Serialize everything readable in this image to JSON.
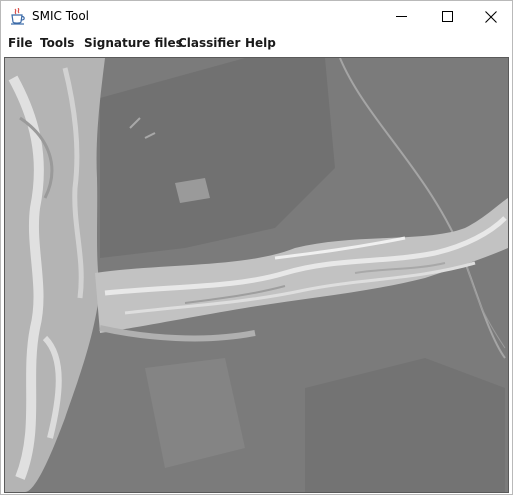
{
  "window": {
    "title": "SMIC Tool",
    "app_icon": "java-coffee-cup-icon",
    "controls": {
      "minimize_icon": "minimize-icon",
      "maximize_icon": "maximize-icon",
      "close_icon": "close-icon"
    }
  },
  "menubar": {
    "items": [
      {
        "label": "File"
      },
      {
        "label": "Tools"
      },
      {
        "label": "Signature files"
      },
      {
        "label": "Classifier"
      },
      {
        "label": "Help"
      }
    ]
  },
  "main": {
    "image_content": "grayscale satellite image of a braided river",
    "colors": {
      "land": "#7b7b7b",
      "river": "#c2c2c2",
      "channel": "#e6e6e6",
      "dark_fields": "#646464"
    }
  }
}
